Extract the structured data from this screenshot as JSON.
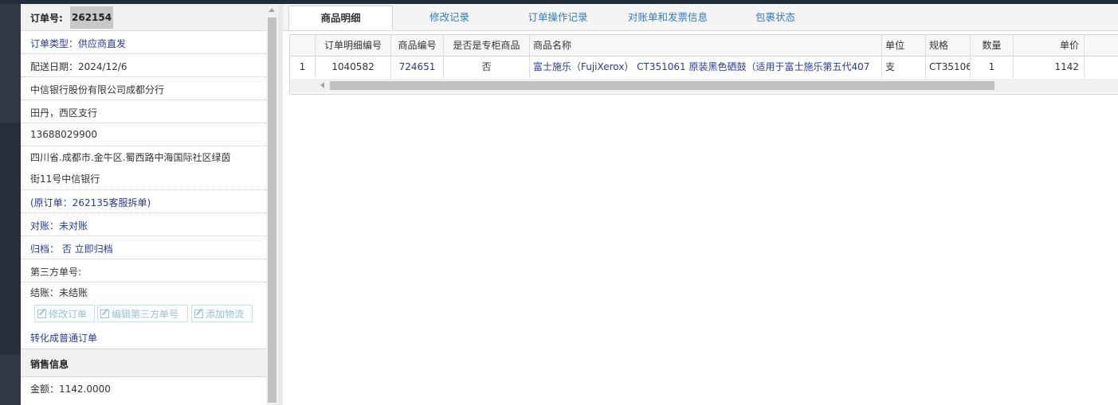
{
  "order": {
    "label": "订单号:",
    "number": "262154",
    "type": "订单类型：供应商直发",
    "ship_date": "配送日期：2024/12/6",
    "company": "中信银行股份有限公司成都分行",
    "contact": "田丹，西区支行",
    "phone": "13688029900",
    "address_line1": "四川省.成都市.金牛区.蜀西路中海国际社区绿茵",
    "address_line2": "街11号中信银行",
    "original_order": "(原订单：262135客服拆单)",
    "reconcile": "对账：未对账",
    "archive": "归档： 否 立即归档",
    "third_party_no": "第三方单号:",
    "settle": "结账：未结账",
    "convert_link": "转化成普通订单"
  },
  "buttons": {
    "edit_order": "修改订单",
    "edit_third_party": "编辑第三方单号",
    "add_logistics": "添加物流"
  },
  "sales": {
    "title": "销售信息",
    "amount": "金额：1142.0000"
  },
  "tabs": [
    "商品明细",
    "修改记录",
    "订单操作记录",
    "对账单和发票信息",
    "包裹状态"
  ],
  "table": {
    "headers": [
      "订单明细编号",
      "商品编号",
      "是否是专柜商品",
      "商品名称",
      "单位",
      "规格",
      "数量",
      "单价"
    ],
    "rows": [
      {
        "index": "1",
        "detail_no": "1040582",
        "product_no": "724651",
        "is_counter": "否",
        "name": "富士施乐（FujiXerox） CT351061 原装黑色硒鼓（适用于富士施乐第五代407",
        "unit": "支",
        "spec": "CT35106",
        "qty": "1",
        "price": "1142"
      }
    ]
  },
  "colors": {
    "link": "#2a3a9a",
    "tab_link": "#2f7dbf",
    "topbar": "#232c3b"
  }
}
